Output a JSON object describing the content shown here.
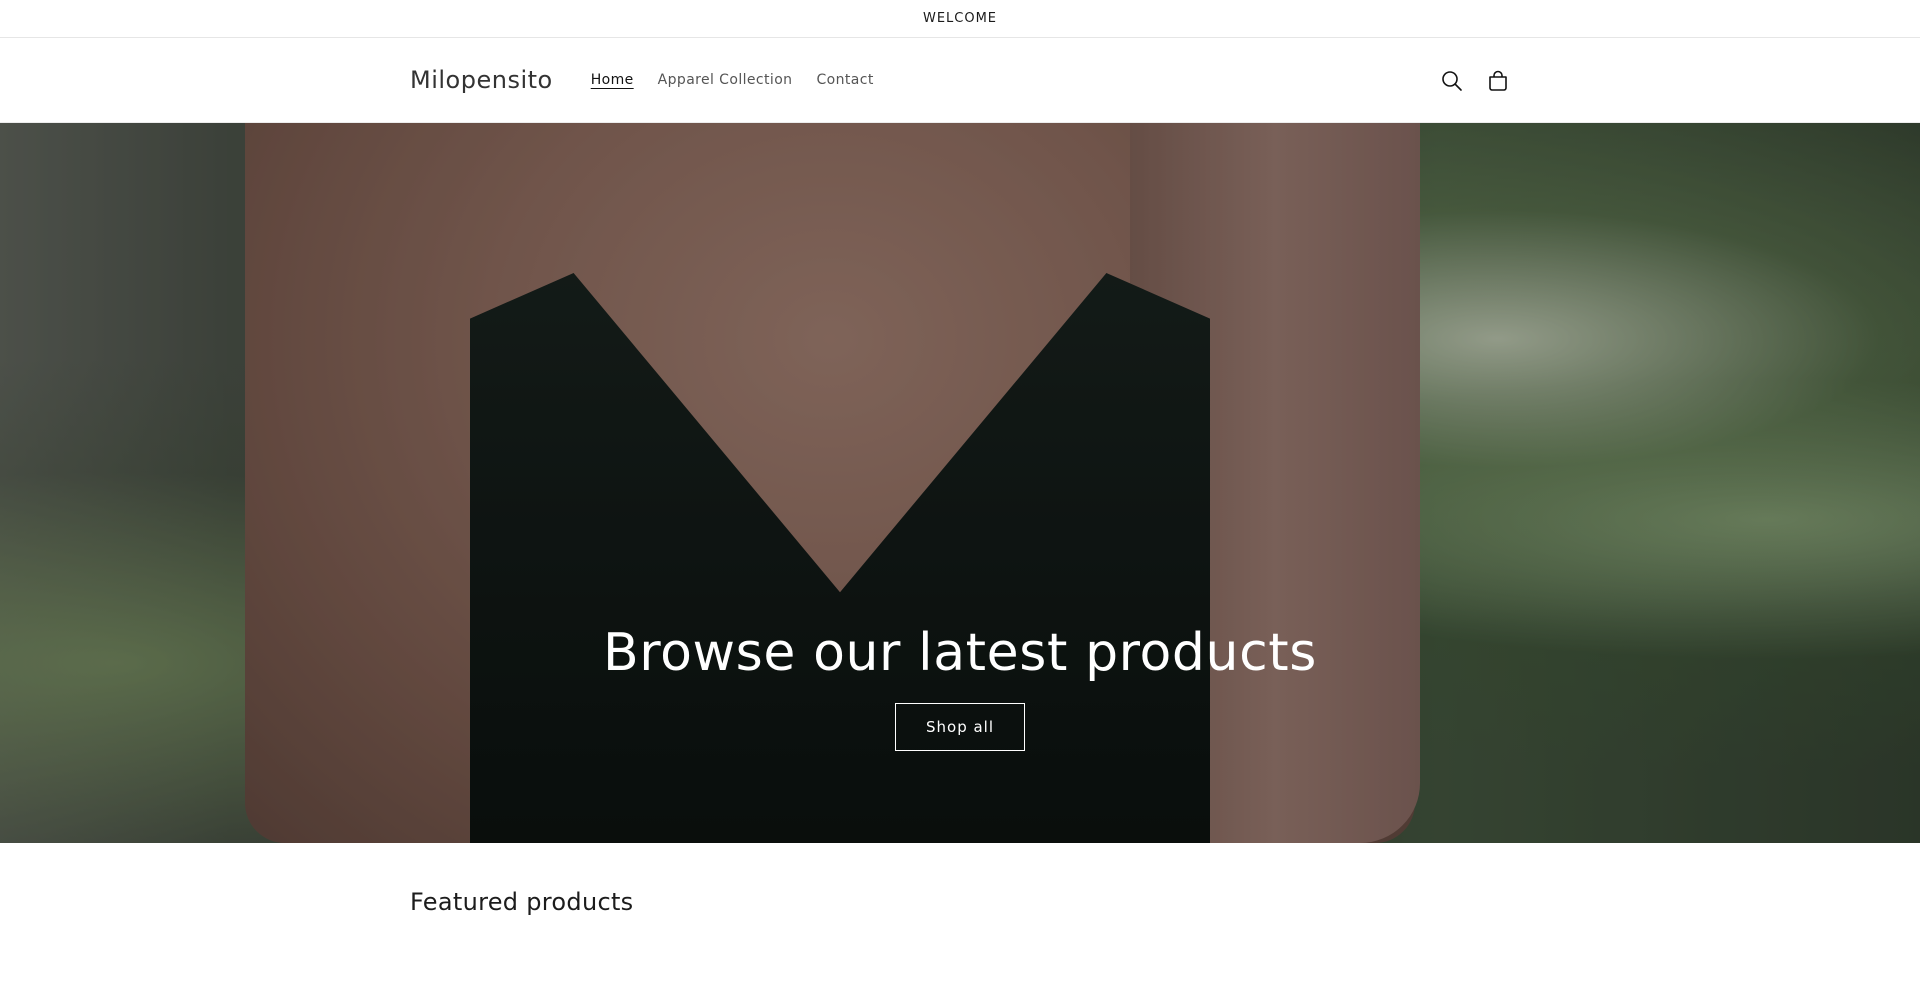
{
  "announcement": {
    "text": "WELCOME"
  },
  "header": {
    "logo": "Milopensito",
    "nav": [
      {
        "label": "Home",
        "active": true
      },
      {
        "label": "Apparel Collection",
        "active": false
      },
      {
        "label": "Contact",
        "active": false
      }
    ],
    "icons": [
      "search-icon",
      "cart-icon"
    ]
  },
  "hero": {
    "title": "Browse our latest products",
    "button_label": "Shop all"
  },
  "featured": {
    "title": "Featured products"
  }
}
